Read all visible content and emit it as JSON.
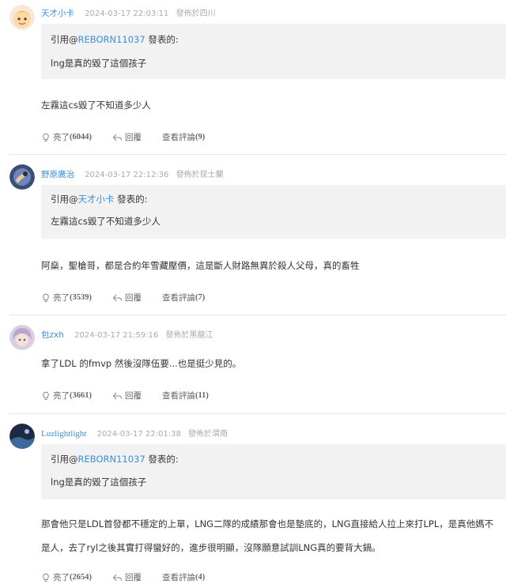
{
  "comments": [
    {
      "username": "天才小卡",
      "time": "2024-03-17 22:03:11",
      "location": "發佈於四川",
      "quote_prefix": "引用@",
      "quote_user": "REBORN11037",
      "quote_suffix": " 發表的:",
      "quote_text": "lng是真的毀了這個孩子",
      "content": "左霧這cs毀了不知道多少人",
      "like_label": "亮了",
      "like_count": "(6044)",
      "reply_label": "回覆",
      "view_label": "查看評論",
      "view_count": "(9)"
    },
    {
      "username": "野原廣治",
      "time": "2024-03-17 22:12:36",
      "location": "發佈於昆士蘭",
      "quote_prefix": "引用@",
      "quote_user": "天才小卡",
      "quote_suffix": " 發表的:",
      "quote_text": "左霧這cs毀了不知道多少人",
      "content": "阿燊，聖槍哥，都是合約年雪藏壓價，這是斷人財路無異於殺人父母，真的畜牲",
      "like_label": "亮了",
      "like_count": "(3539)",
      "reply_label": "回覆",
      "view_label": "查看評論",
      "view_count": "(7)"
    },
    {
      "username": "包zxh",
      "time": "2024-03-17 21:59:16",
      "location": "發佈於黑龍江",
      "content": "拿了LDL 的fmvp 然後沒隊伍要...也是挺少見的。",
      "like_label": "亮了",
      "like_count": "(3661)",
      "reply_label": "回覆",
      "view_label": "查看評論",
      "view_count": "(11)"
    },
    {
      "username": "Luzlightlight",
      "time": "2024-03-17 22:01:38",
      "location": "發佈於渭南",
      "quote_prefix": "引用@",
      "quote_user": "REBORN11037",
      "quote_suffix": " 發表的:",
      "quote_text": "lng是真的毀了這個孩子",
      "content": "那會他只是LDL首發都不穩定的上單，LNG二隊的成績那會也是墊底的，LNG直接給人拉上來打LPL，是真他媽不是人，去了ryl之後其實打得蠻好的，進步很明顯，沒隊願意試訓LNG真的要背大鍋。",
      "like_label": "亮了",
      "like_count": "(2654)",
      "reply_label": "回覆",
      "view_label": "查看評論",
      "view_count": "(4)"
    }
  ],
  "colors": {
    "link": "#3d8fd4",
    "quote_bg": "#f2f2f3",
    "meta": "#aaaaaa"
  },
  "icons": {
    "like": "lightbulb-icon",
    "reply": "reply-arrow-icon"
  }
}
